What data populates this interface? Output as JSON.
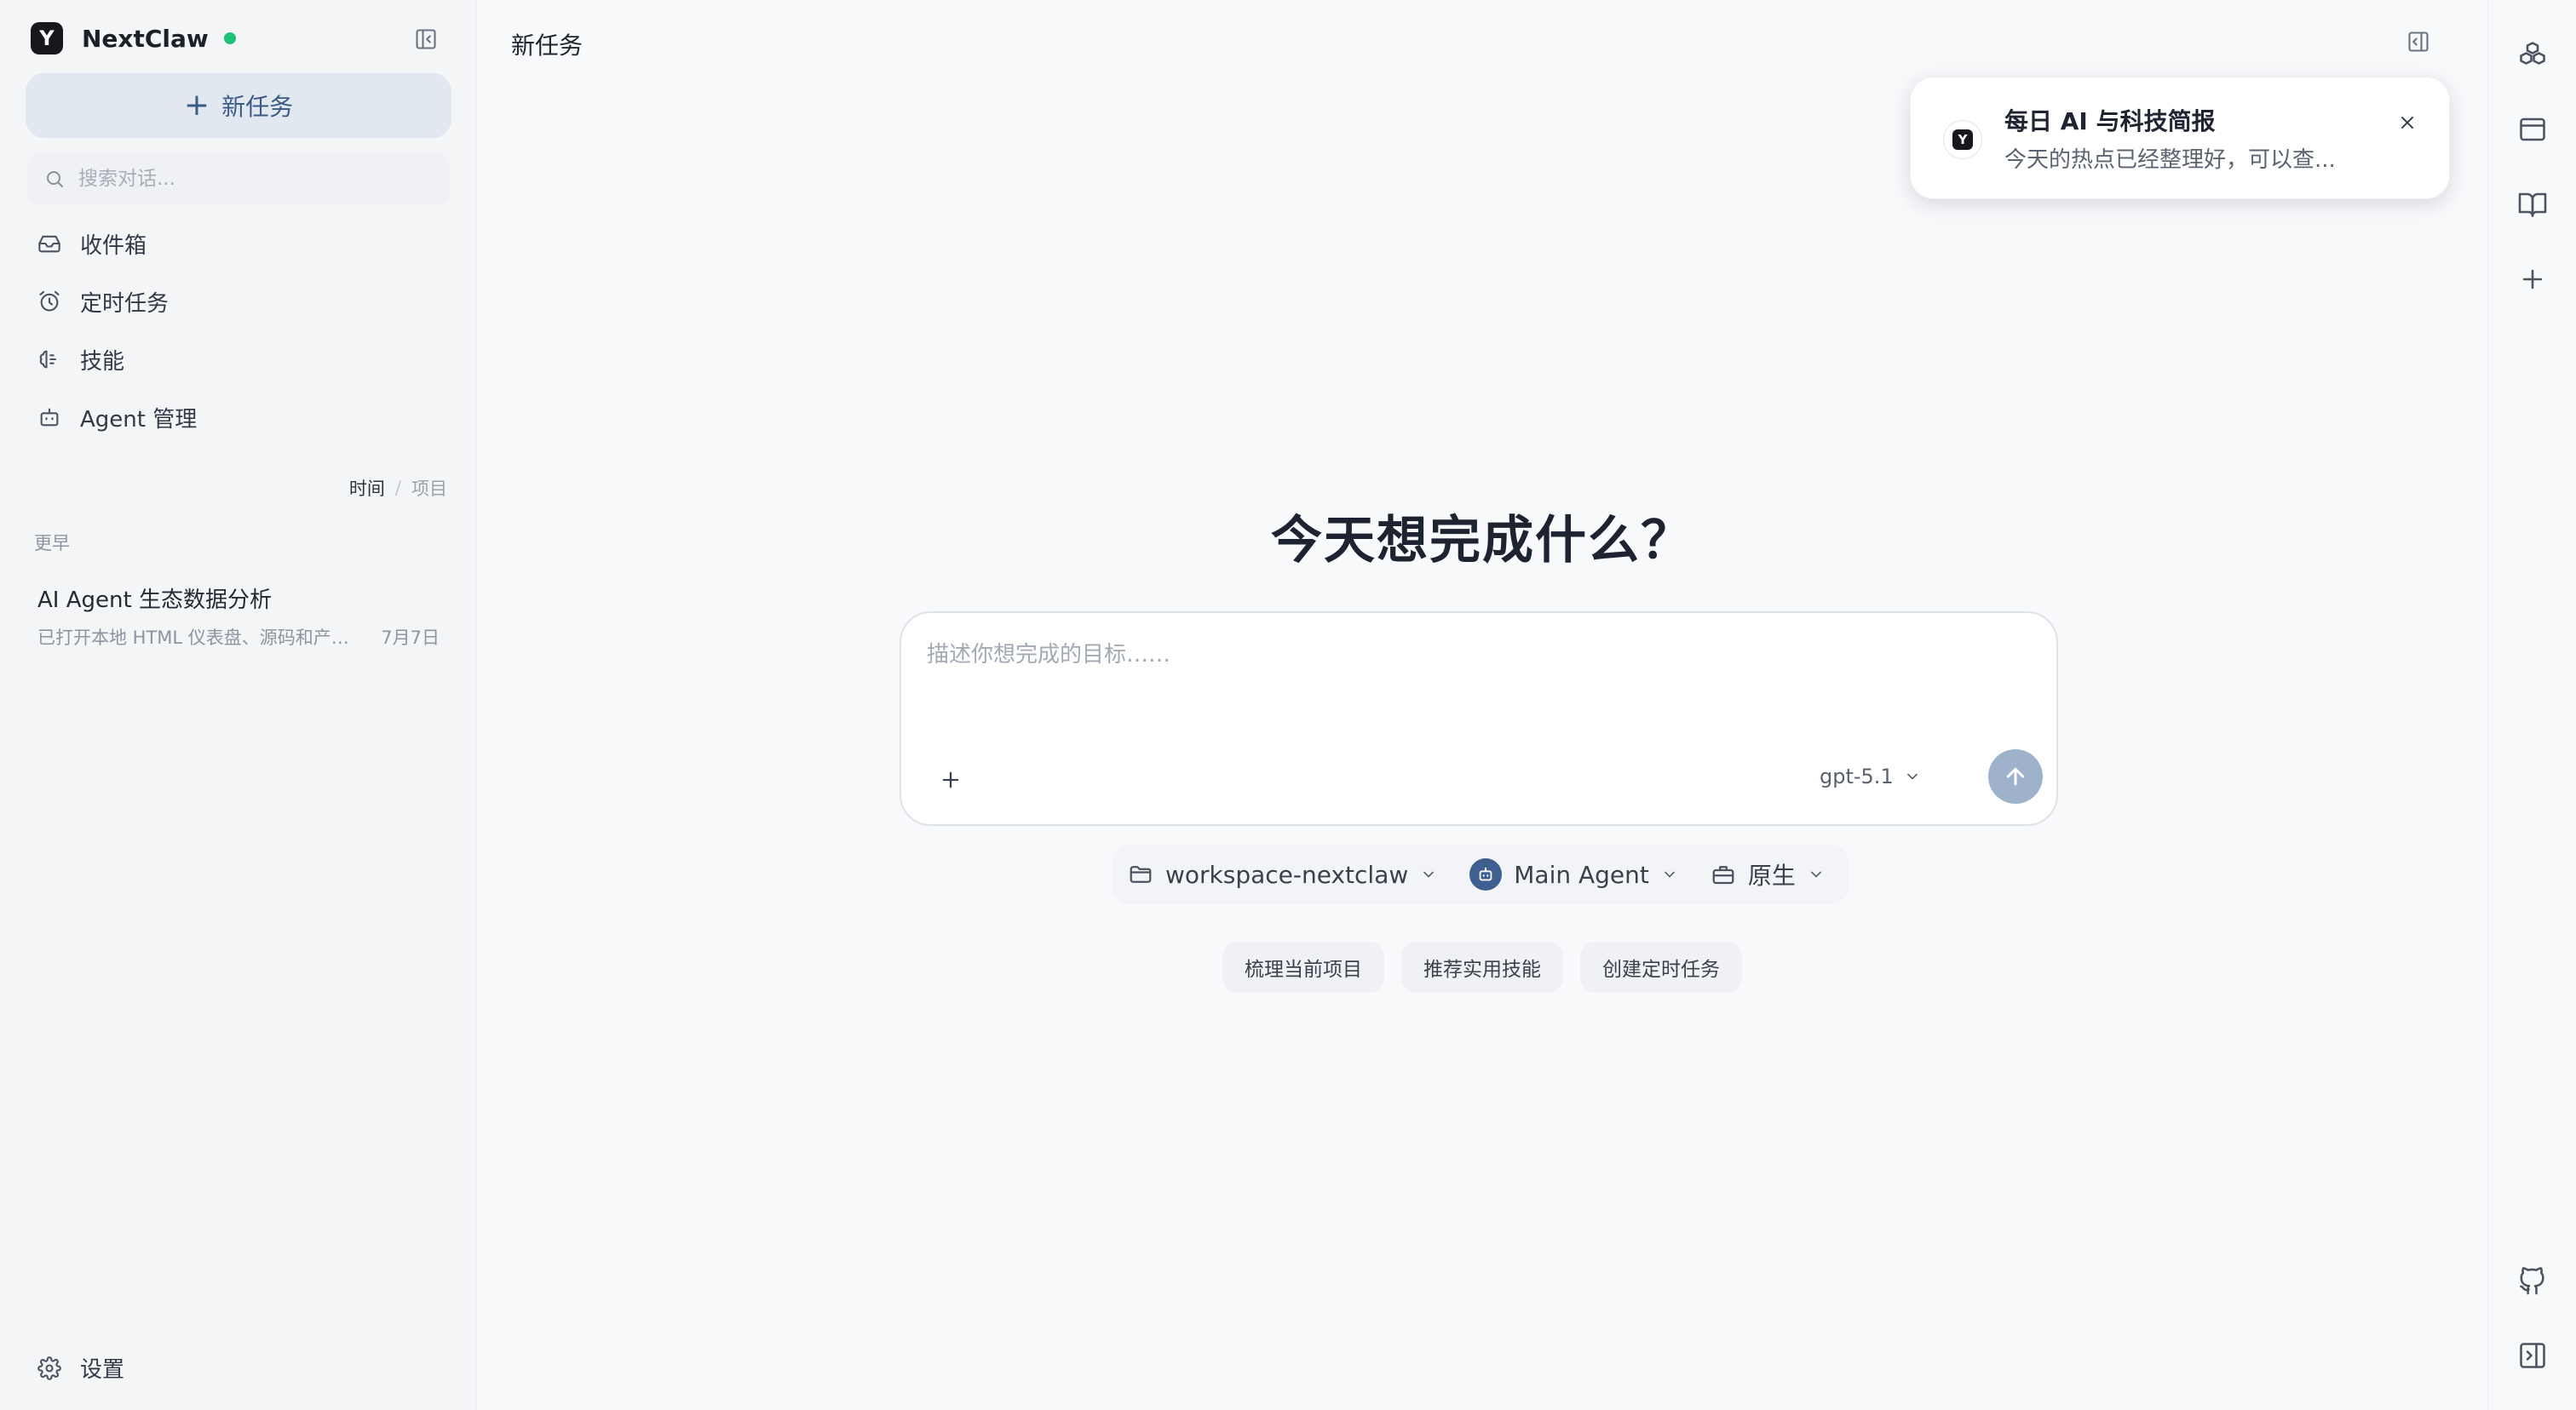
{
  "app": {
    "name": "NextClaw",
    "logo_letter": "Y",
    "status_color": "#1ec27a"
  },
  "sidebar": {
    "new_task_label": "新任务",
    "search_placeholder": "搜索对话...",
    "nav": [
      {
        "label": "收件箱",
        "icon": "inbox-icon"
      },
      {
        "label": "定时任务",
        "icon": "alarm-clock-icon"
      },
      {
        "label": "技能",
        "icon": "brain-icon"
      },
      {
        "label": "Agent 管理",
        "icon": "bot-icon"
      }
    ],
    "sort": {
      "active": "时间",
      "separator": "/",
      "inactive": "项目"
    },
    "group_label": "更早",
    "sessions": [
      {
        "title": "AI Agent 生态数据分析",
        "preview": "已打开本地 HTML 仪表盘、源码和产…",
        "date": "7月7日"
      }
    ],
    "settings_label": "设置"
  },
  "main": {
    "page_title": "新任务",
    "hero_title": "今天想完成什么？",
    "composer": {
      "placeholder": "描述你想完成的目标……",
      "model": "gpt-5.1"
    },
    "context": {
      "workspace": "workspace-nextclaw",
      "agent": "Main Agent",
      "runtime": "原生"
    },
    "suggestions": [
      "梳理当前项目",
      "推荐实用技能",
      "创建定时任务"
    ]
  },
  "toast": {
    "title": "每日 AI 与科技简报",
    "body": "今天的热点已经整理好，可以查..."
  },
  "rail": {
    "icons": [
      "cubes-icon",
      "browser-window-icon",
      "book-open-icon",
      "plus-icon",
      "github-icon",
      "panel-right-icon"
    ]
  },
  "colors": {
    "accent": "#3b5a85",
    "send_button": "#9fb2cc",
    "sidebar_bg": "#f4f5f7",
    "main_bg": "#f8f9fb"
  }
}
